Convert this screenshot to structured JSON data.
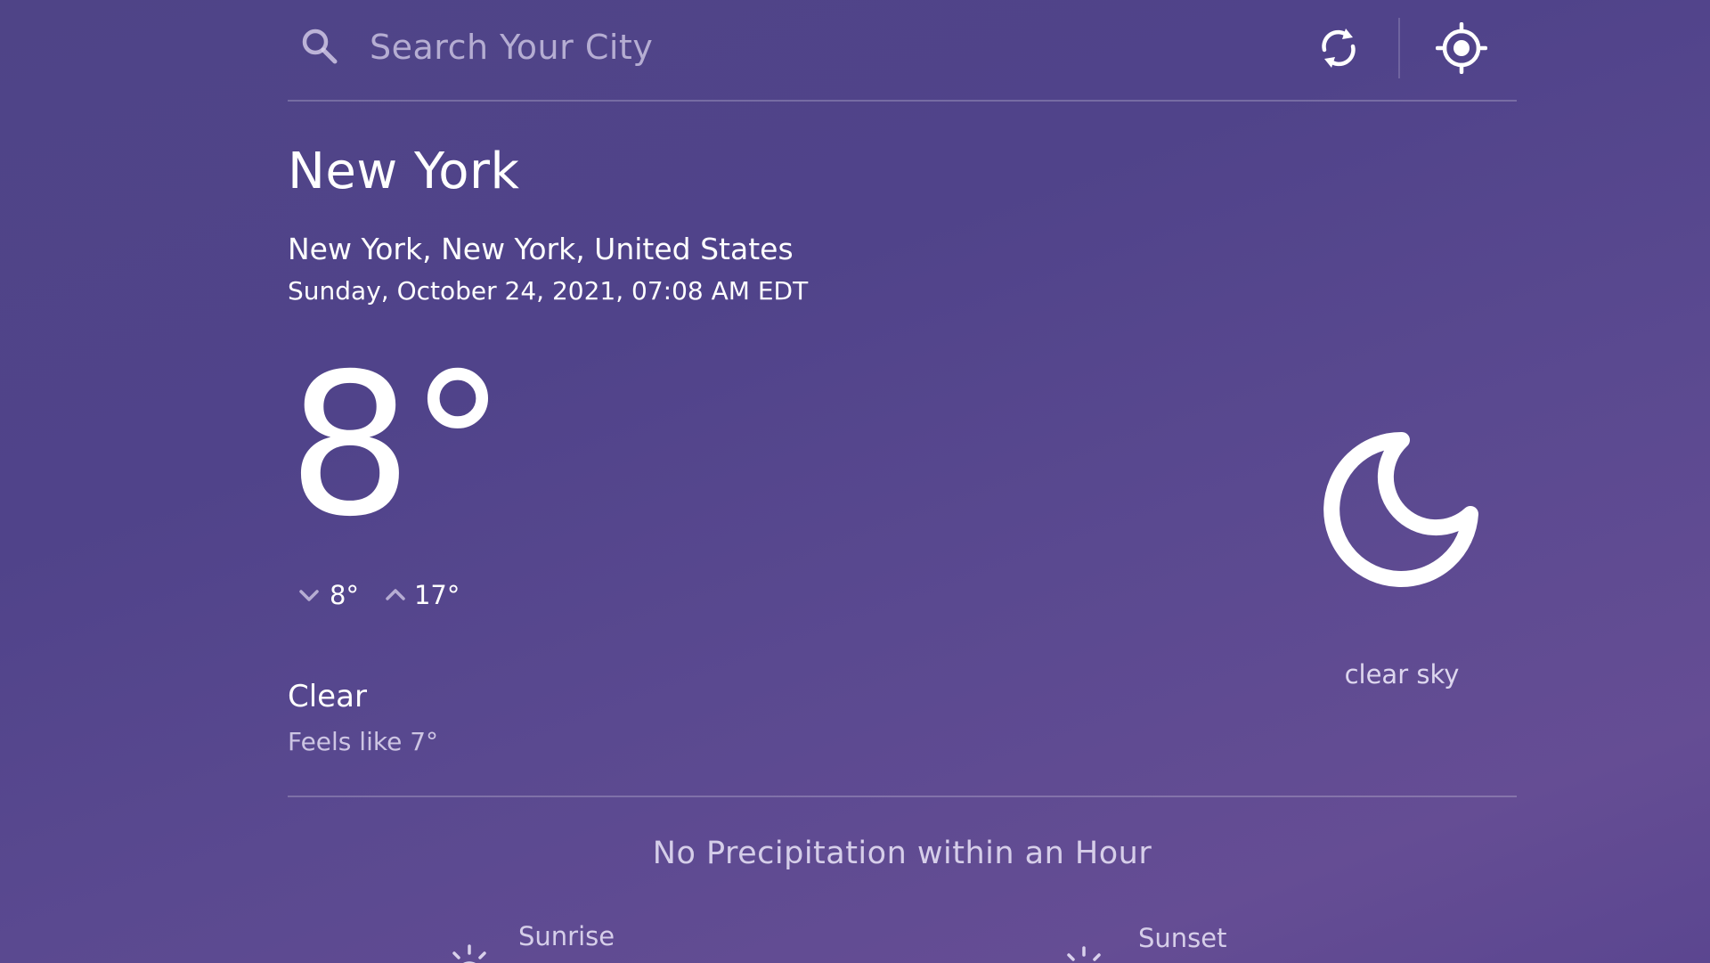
{
  "search": {
    "placeholder": "Search Your City",
    "value": ""
  },
  "location": {
    "city": "New York",
    "full": "New York, New York, United States",
    "datetime": "Sunday, October 24, 2021, 07:08 AM EDT"
  },
  "weather": {
    "temperature": "8°",
    "min": "8°",
    "max": "17°",
    "condition": "Clear",
    "feels_like": "Feels like 7°",
    "description": "clear sky",
    "icon": "moon-icon",
    "precipitation": "No Precipitation within an Hour"
  },
  "sun": {
    "sunrise_label": "Sunrise",
    "sunset_label": "Sunset"
  },
  "colors": {
    "background_top": "#4f4487",
    "background_bottom": "#654d94",
    "text": "#ffffff"
  }
}
